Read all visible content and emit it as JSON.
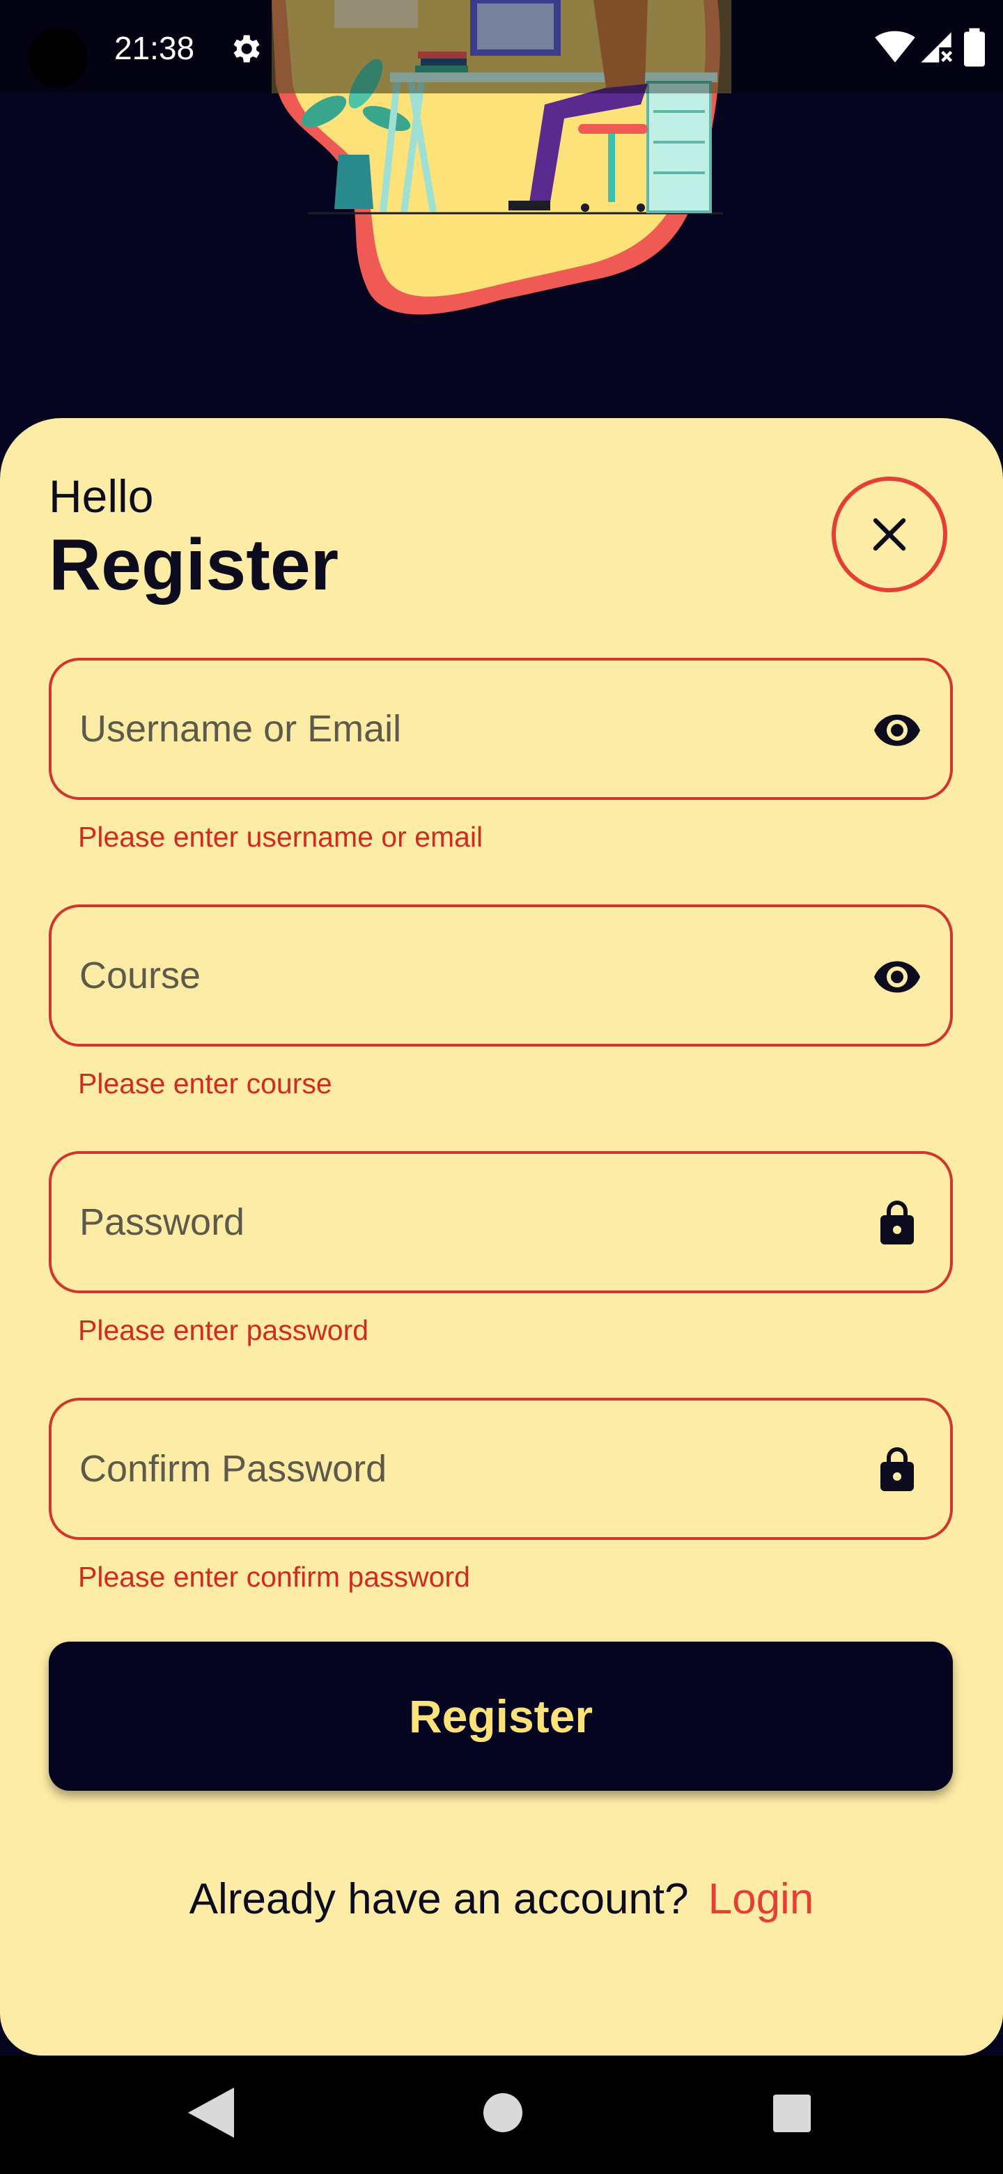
{
  "status_bar": {
    "time": "21:38"
  },
  "header": {
    "greeting": "Hello",
    "title": "Register"
  },
  "form": {
    "fields": [
      {
        "placeholder": "Username or Email",
        "error": "Please enter username or email",
        "icon": "eye-icon"
      },
      {
        "placeholder": "Course",
        "error": "Please enter course",
        "icon": "eye-icon"
      },
      {
        "placeholder": "Password",
        "error": "Please enter password",
        "icon": "lock-icon"
      },
      {
        "placeholder": "Confirm Password",
        "error": "Please enter confirm password",
        "icon": "lock-icon"
      }
    ],
    "submit_label": "Register"
  },
  "footer": {
    "prompt": "Already have an account?",
    "link": "Login"
  },
  "colors": {
    "background": "#06051f",
    "card": "#fdeca6",
    "accent": "#e53f35",
    "error": "#d02a21",
    "button_text": "#fde27a"
  }
}
